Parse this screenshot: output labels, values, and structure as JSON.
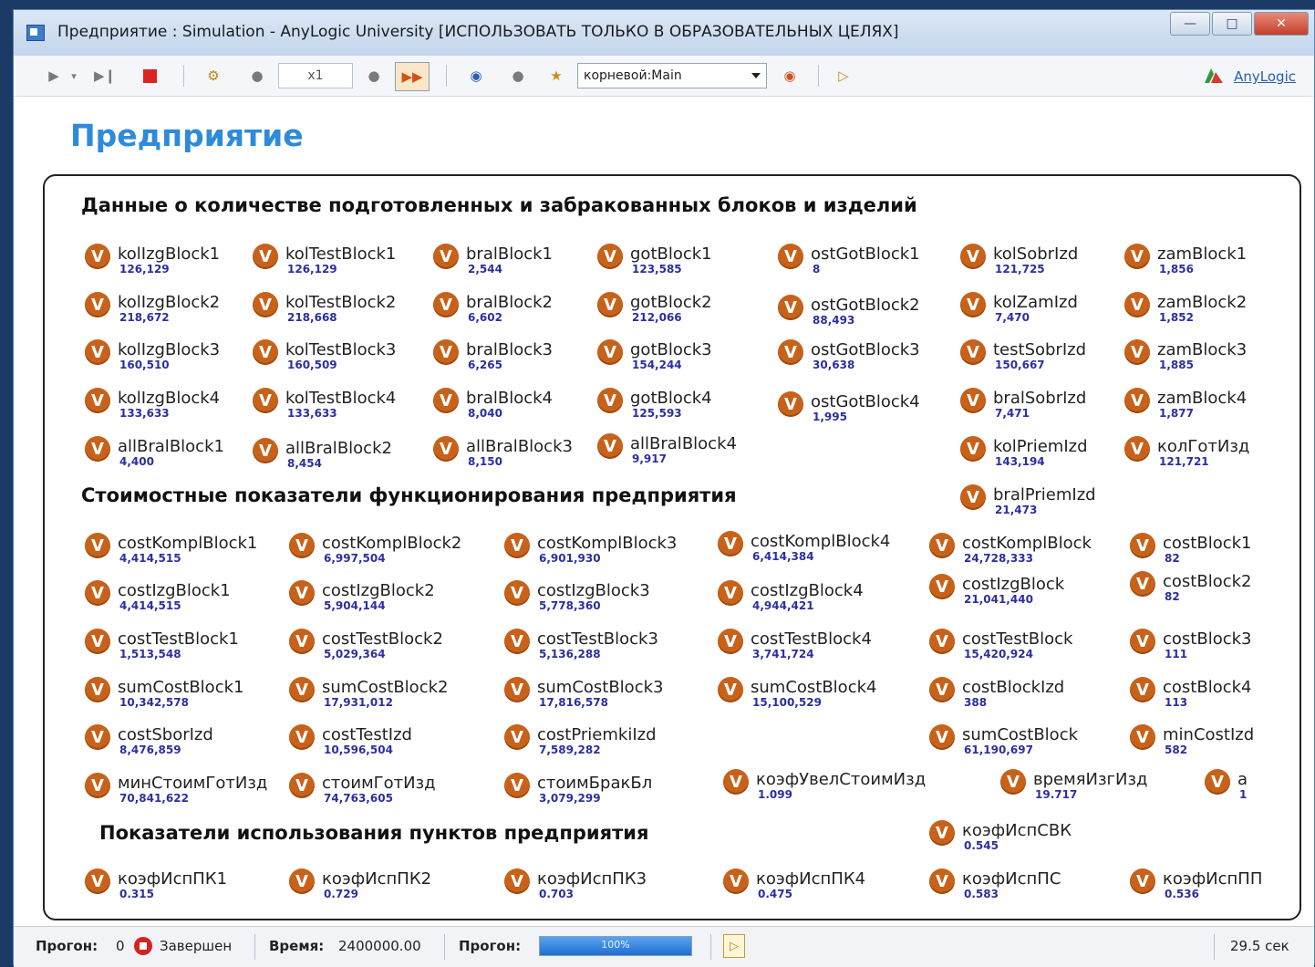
{
  "window": {
    "title": "Предприятие : Simulation - AnyLogic University  [ИСПОЛЬЗОВАТЬ ТОЛЬКО В ОБРАЗОВАТЕЛЬНЫХ ЦЕЛЯХ]",
    "min_icon": "minimize-icon",
    "max_icon": "maximize-icon",
    "close_icon": "close-icon"
  },
  "toolbar": {
    "speed": "x1",
    "root_selector": "корневой:Main",
    "brand_link": "AnyLogic"
  },
  "page_title": "Предприятие",
  "sections": {
    "blocks": "Данные о количестве подготовленных и забракованных блоков и изделий",
    "cost": "Стоимостные показатели функционирования предприятия",
    "usage": "Показатели использования пунктов предприятия"
  },
  "variables": [
    {
      "name": "kolIzgBlock1",
      "value": "126,129"
    },
    {
      "name": "kolTestBlock1",
      "value": "126,129"
    },
    {
      "name": "bralBlock1",
      "value": "2,544"
    },
    {
      "name": "gotBlock1",
      "value": "123,585"
    },
    {
      "name": "ostGotBlock1",
      "value": "8"
    },
    {
      "name": "kolSobrIzd",
      "value": "121,725"
    },
    {
      "name": "zamBlock1",
      "value": "1,856"
    },
    {
      "name": "kolIzgBlock2",
      "value": "218,672"
    },
    {
      "name": "kolTestBlock2",
      "value": "218,668"
    },
    {
      "name": "bralBlock2",
      "value": "6,602"
    },
    {
      "name": "gotBlock2",
      "value": "212,066"
    },
    {
      "name": "ostGotBlock2",
      "value": "88,493"
    },
    {
      "name": "kolZamIzd",
      "value": "7,470"
    },
    {
      "name": "zamBlock2",
      "value": "1,852"
    },
    {
      "name": "kolIzgBlock3",
      "value": "160,510"
    },
    {
      "name": "kolTestBlock3",
      "value": "160,509"
    },
    {
      "name": "bralBlock3",
      "value": "6,265"
    },
    {
      "name": "gotBlock3",
      "value": "154,244"
    },
    {
      "name": "ostGotBlock3",
      "value": "30,638"
    },
    {
      "name": "testSobrIzd",
      "value": "150,667"
    },
    {
      "name": "zamBlock3",
      "value": "1,885"
    },
    {
      "name": "kolIzgBlock4",
      "value": "133,633"
    },
    {
      "name": "kolTestBlock4",
      "value": "133,633"
    },
    {
      "name": "bralBlock4",
      "value": "8,040"
    },
    {
      "name": "gotBlock4",
      "value": "125,593"
    },
    {
      "name": "ostGotBlock4",
      "value": "1,995"
    },
    {
      "name": "bralSobrIzd",
      "value": "7,471"
    },
    {
      "name": "zamBlock4",
      "value": "1,877"
    },
    {
      "name": "allBralBlock1",
      "value": "4,400"
    },
    {
      "name": "allBralBlock2",
      "value": "8,454"
    },
    {
      "name": "allBralBlock3",
      "value": "8,150"
    },
    {
      "name": "allBralBlock4",
      "value": "9,917"
    },
    {
      "name": "kolPriemIzd",
      "value": "143,194"
    },
    {
      "name": "колГотИзд",
      "value": "121,721"
    },
    {
      "name": "bralPriemIzd",
      "value": "21,473"
    },
    {
      "name": "costKomplBlock1",
      "value": "4,414,515"
    },
    {
      "name": "costKomplBlock2",
      "value": "6,997,504"
    },
    {
      "name": "costKomplBlock3",
      "value": "6,901,930"
    },
    {
      "name": "costKomplBlock4",
      "value": "6,414,384"
    },
    {
      "name": "costKomplBlock",
      "value": "24,728,333"
    },
    {
      "name": "costBlock1",
      "value": "82"
    },
    {
      "name": "costIzgBlock1",
      "value": "4,414,515"
    },
    {
      "name": "costIzgBlock2",
      "value": "5,904,144"
    },
    {
      "name": "costIzgBlock3",
      "value": "5,778,360"
    },
    {
      "name": "costIzgBlock4",
      "value": "4,944,421"
    },
    {
      "name": "costIzgBlock",
      "value": "21,041,440"
    },
    {
      "name": "costBlock2",
      "value": "82"
    },
    {
      "name": "costTestBlock1",
      "value": "1,513,548"
    },
    {
      "name": "costTestBlock2",
      "value": "5,029,364"
    },
    {
      "name": "costTestBlock3",
      "value": "5,136,288"
    },
    {
      "name": "costTestBlock4",
      "value": "3,741,724"
    },
    {
      "name": "costTestBlock",
      "value": "15,420,924"
    },
    {
      "name": "costBlock3",
      "value": "111"
    },
    {
      "name": "sumCostBlock1",
      "value": "10,342,578"
    },
    {
      "name": "sumCostBlock2",
      "value": "17,931,012"
    },
    {
      "name": "sumCostBlock3",
      "value": "17,816,578"
    },
    {
      "name": "sumCostBlock4",
      "value": "15,100,529"
    },
    {
      "name": "costBlockIzd",
      "value": "388"
    },
    {
      "name": "costBlock4",
      "value": "113"
    },
    {
      "name": "costSborIzd",
      "value": "8,476,859"
    },
    {
      "name": "costTestIzd",
      "value": "10,596,504"
    },
    {
      "name": "costPriemkiIzd",
      "value": "7,589,282"
    },
    {
      "name": "sumCostBlock",
      "value": "61,190,697"
    },
    {
      "name": "minCostIzd",
      "value": "582"
    },
    {
      "name": "минСтоимГотИзд",
      "value": "70,841,622"
    },
    {
      "name": "стоимГотИзд",
      "value": "74,763,605"
    },
    {
      "name": "стоимБракБл",
      "value": "3,079,299"
    },
    {
      "name": "коэфУвелСтоимИзд",
      "value": "1.099"
    },
    {
      "name": "времяИзгИзд",
      "value": "19.717"
    },
    {
      "name": "a",
      "value": "1"
    },
    {
      "name": "коэфИспСВК",
      "value": "0.545"
    },
    {
      "name": "коэфИспПК1",
      "value": "0.315"
    },
    {
      "name": "коэфИспПК2",
      "value": "0.729"
    },
    {
      "name": "коэфИспПК3",
      "value": "0.703"
    },
    {
      "name": "коэфИспПК4",
      "value": "0.475"
    },
    {
      "name": "коэфИспПС",
      "value": "0.583"
    },
    {
      "name": "коэфИспПП",
      "value": "0.536"
    }
  ],
  "status": {
    "run_label": "Прогон:",
    "run_number": "0",
    "run_state": "Завершен",
    "time_label": "Время:",
    "time_value": "2400000.00",
    "progress_label": "Прогон:",
    "progress_text": "100%",
    "progress_fraction": 1.0,
    "elapsed": "29.5 сек"
  }
}
